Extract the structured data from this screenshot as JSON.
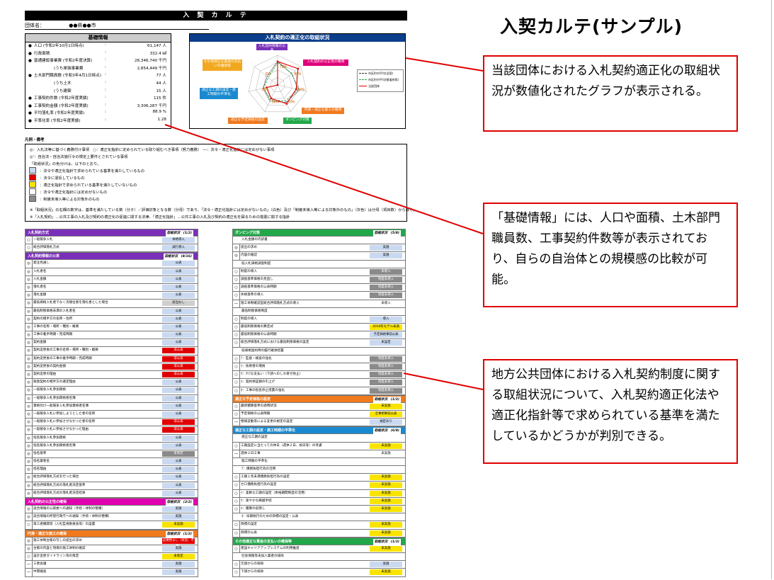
{
  "header": {
    "title": "入 契 カ ル テ",
    "org_label": "団体名：",
    "org_value": "●●県●●市"
  },
  "page_title": "入契カルテ(サンプル)",
  "basic_info": {
    "title": "基礎情報",
    "rows": [
      {
        "label": "人口 (令和2年10月1日時点)",
        "value": "61,147 人",
        "bullet": true
      },
      {
        "label": "行政面積",
        "value": "332.4 ㎢",
        "bullet": true
      },
      {
        "label": "普通建設事業費 (令和2年度決算)",
        "value": "28,346,740 千円",
        "bullet": true
      },
      {
        "label": "(うち単独事業費",
        "value": "2,854,449 千円",
        "bullet": false
      },
      {
        "label": "土木部門職員数 (令和3年4月1日時点)",
        "value": "77 人",
        "bullet": true
      },
      {
        "label": "(うち土木",
        "value": "44 人",
        "bullet": false
      },
      {
        "label": "(うち建築",
        "value": "15 人",
        "bullet": false
      },
      {
        "label": "工事契約件数 (令和2年度実績)",
        "value": "115 件",
        "bullet": true
      },
      {
        "label": "工事契約金額 (令和2年度実績)",
        "value": "3,306,287 千円",
        "bullet": true
      },
      {
        "label": "平均落札率 (令和2年度実績)",
        "value": "88.9 %",
        "bullet": true
      },
      {
        "label": "平準化率 (令和2年度実績)",
        "value": "1.28",
        "bullet": true
      }
    ]
  },
  "chart": {
    "title": "入札契約の適正化の取組状況",
    "categories": [
      {
        "label": "入札契約情報の公表",
        "color": "#7a2fb8"
      },
      {
        "label": "入札契約の公正性の確保",
        "color": "#e0007a"
      },
      {
        "label": "円滑・適正な施工の確保",
        "color": "#f07a1e"
      },
      {
        "label": "ダンピング対策",
        "color": "#22a84a"
      },
      {
        "label": "適正な予定価格の設定",
        "color": "#f07a1e"
      },
      {
        "label": "適正な工期の設定・施工時期の平準化",
        "color": "#1a8ad0"
      },
      {
        "label": "その他適正な賃金の支払いの確保等",
        "color": "#f2a81e"
      }
    ],
    "legend": [
      "市区町村平均(全国)",
      "市区町村平均(都道府県)",
      "当該団体"
    ],
    "percent_labels": [
      "79%",
      "88%",
      "64%",
      "70%",
      "50%",
      "38%",
      "0%"
    ]
  },
  "chart_data": {
    "type": "radar",
    "categories": [
      "入札契約情報の公表",
      "入札契約の公正性の確保",
      "円滑・適正な施工の確保",
      "ダンピング対策",
      "適正な予定価格の設定",
      "適正な工期の設定・施工時期の平準化",
      "その他適正な賃金の支払いの確保等"
    ],
    "series": [
      {
        "name": "市区町村平均(全国)",
        "values": [
          80,
          60,
          75,
          65,
          60,
          50,
          45
        ]
      },
      {
        "name": "市区町村平均(都道府県)",
        "values": [
          75,
          62,
          70,
          60,
          55,
          48,
          40
        ]
      },
      {
        "name": "当該団体",
        "values": [
          79,
          88,
          64,
          70,
          50,
          38,
          0
        ]
      }
    ]
  },
  "legend_box": {
    "heading": "凡例・備考",
    "lines": [
      "◎：入札法等に基づく義務付け事項　○：適正化指針に定められている取り組むべき事項（努力義務）　―：法令・適正化指針には定めがない事項",
      "◎'：自治法・自治法施行令の規定上要件とされている事項",
      "「取組状況」の色分けは、以下のとおり。",
      "：法令や適正化指針で求められている基準を満たしているもの",
      "：法令に違反しているもの",
      "：適正化指針で求められている基準を満たしていないもの",
      "：法令や適正化指針には定めがないもの",
      "：制度未導入等による対象外のもの",
      "※「取組状況」の右欄の数字は、基準を満たしている数（分子）／評価対象となる数（分母）であり、「法令・適正化指針には定めがないもの」（白色）及び「制度未導入等による対象外のもの」（灰色）は分母（項目数）から除く。",
      "※「入札契約」…公共工事の入札及び契約の適正化の促進に関する法律、「適正化指針」…公共工事の入札及び契約の適正化を図るための措置に関する指針"
    ],
    "swatch_colors": [
      "#c9d9f0",
      "#e00000",
      "#f8e400",
      "#ffffff",
      "#8a8a8a"
    ]
  },
  "left_table": [
    {
      "kind": "hdr",
      "label": "入札契約方式",
      "status": "取組状況　(1/2)",
      "color": "#7a2fb8"
    },
    {
      "kind": "row",
      "mark": "○",
      "label": "一般競争入札",
      "value": "本格導入",
      "color": "#c9d9f0"
    },
    {
      "kind": "row",
      "mark": "○",
      "label": "総合評価落札方式",
      "value": "試行導入",
      "color": "#c9d9f0"
    },
    {
      "kind": "hdr",
      "label": "入札契約情報の公表",
      "status": "取組状況　(8/16)",
      "color": "#7a2fb8"
    },
    {
      "kind": "row",
      "mark": "◎",
      "label": "発注見通し",
      "value": "公表",
      "color": "#c9d9f0"
    },
    {
      "kind": "row",
      "mark": "◎",
      "label": "入札者名",
      "value": "公表",
      "color": "#c9d9f0"
    },
    {
      "kind": "row",
      "mark": "◎",
      "label": "入札金額",
      "value": "公表",
      "color": "#c9d9f0"
    },
    {
      "kind": "row",
      "mark": "◎",
      "label": "落札者名",
      "value": "公表",
      "color": "#c9d9f0"
    },
    {
      "kind": "row",
      "mark": "◎",
      "label": "落札金額",
      "value": "公表",
      "color": "#c9d9f0"
    },
    {
      "kind": "row",
      "mark": "◎",
      "label": "最低価格入札者でなく次順位者を落札者とした場合",
      "value": "該当なし",
      "color": "#cfcfcf"
    },
    {
      "kind": "row",
      "mark": "◎",
      "label": "最低制限価格未満の入札者名",
      "value": "公表",
      "color": "#c9d9f0"
    },
    {
      "kind": "row",
      "mark": "◎",
      "label": "契約の相手方の名称・住所",
      "value": "公表",
      "color": "#c9d9f0"
    },
    {
      "kind": "row",
      "mark": "◎",
      "label": "工事の名称・場所・種別・概要",
      "value": "公表",
      "color": "#c9d9f0"
    },
    {
      "kind": "row",
      "mark": "◎",
      "label": "工事の着手時期・完成時期",
      "value": "公表",
      "color": "#c9d9f0"
    },
    {
      "kind": "row",
      "mark": "◎",
      "label": "契約金額",
      "value": "公表",
      "color": "#c9d9f0"
    },
    {
      "kind": "row",
      "mark": "◎",
      "label": "契約変更後の工事の名称・場所・種別・概要",
      "value": "非公表",
      "color": "#e00000"
    },
    {
      "kind": "row",
      "mark": "◎",
      "label": "契約変更後の工事の着手時期・完成時期",
      "value": "非公表",
      "color": "#e00000"
    },
    {
      "kind": "row",
      "mark": "◎",
      "label": "契約変更後の契約金額",
      "value": "非公表",
      "color": "#e00000"
    },
    {
      "kind": "row",
      "mark": "◎",
      "label": "契約変更の理由",
      "value": "非公表",
      "color": "#e00000"
    },
    {
      "kind": "row",
      "mark": "◎",
      "label": "随意契約の相手方の選定理由",
      "value": "公表",
      "color": "#c9d9f0"
    },
    {
      "kind": "row",
      "mark": "◎",
      "label": "一般競争入札参加資格",
      "value": "公表",
      "color": "#c9d9f0"
    },
    {
      "kind": "row",
      "mark": "◎",
      "label": "一般競争入札参加資格者名簿",
      "value": "公表",
      "color": "#c9d9f0"
    },
    {
      "kind": "row",
      "mark": "◎",
      "label": "資格付け一般競争入札参加資格者名簿",
      "value": "公表",
      "color": "#c9d9f0"
    },
    {
      "kind": "row",
      "mark": "◎",
      "label": "一般競争入札に参加しようとした者の名称",
      "value": "公表",
      "color": "#c9d9f0"
    },
    {
      "kind": "row",
      "mark": "◎",
      "label": "一般競争入札に参加させなかった者の名称",
      "value": "非公表",
      "color": "#e00000"
    },
    {
      "kind": "row",
      "mark": "◎",
      "label": "一般競争入札に参加させなかった理由",
      "value": "非公表",
      "color": "#e00000"
    },
    {
      "kind": "row",
      "mark": "◎",
      "label": "指名競争入札参加資格",
      "value": "公表",
      "color": "#c9d9f0"
    },
    {
      "kind": "row",
      "mark": "◎",
      "label": "指名競争入札参加資格者名簿",
      "value": "公表",
      "color": "#c9d9f0"
    },
    {
      "kind": "row",
      "mark": "◎",
      "label": "指名基準",
      "value": "未制定",
      "color": "#8a8a8a"
    },
    {
      "kind": "row",
      "mark": "◎",
      "label": "指名業者名",
      "value": "公表",
      "color": "#c9d9f0"
    },
    {
      "kind": "row",
      "mark": "◎",
      "label": "指名理由",
      "value": "公表",
      "color": "#c9d9f0"
    },
    {
      "kind": "row",
      "mark": "◎",
      "label": "総合評価落札方式を行った場合",
      "value": "公表",
      "color": "#c9d9f0"
    },
    {
      "kind": "row",
      "mark": "◎",
      "label": "総合評価落札方式の落札者決定基準",
      "value": "公表",
      "color": "#c9d9f0"
    },
    {
      "kind": "row",
      "mark": "◎",
      "label": "総合評価落札方式の落札者決定結果",
      "value": "公表",
      "color": "#c9d9f0"
    },
    {
      "kind": "hdr",
      "label": "入札契約の公正性の確保",
      "status": "取組状況　(2/2)",
      "color": "#e000b0"
    },
    {
      "kind": "row",
      "mark": "◎",
      "label": "談合情報の公取委への通知（手続・体制の整備）",
      "value": "実施",
      "color": "#c9d9f0"
    },
    {
      "kind": "row",
      "mark": "◎",
      "label": "談合情報の所管行政庁への通知（手続・体制の整備）",
      "value": "実施",
      "color": "#c9d9f0"
    },
    {
      "kind": "row",
      "mark": "○",
      "label": "第三者機関等（入札監視委員会等）の設置",
      "value": "未実施",
      "color": "#f8e400"
    },
    {
      "kind": "hdr",
      "label": "円滑・適正な施工の確保",
      "status": "取組状況　(1/2)",
      "color": "#f07a1e"
    },
    {
      "kind": "row",
      "mark": "◎",
      "label": "施工体制台帳の写しの提出の求め",
      "value": "必要性なし（状況：不適）",
      "color": "#e00000"
    },
    {
      "kind": "row",
      "mark": "◎",
      "label": "台帳の内容と現場の施工体制の確認",
      "value": "実施",
      "color": "#c9d9f0"
    },
    {
      "kind": "row",
      "mark": "○",
      "label": "設計変更ガイドライン等の策定",
      "value": "未策定",
      "color": "#f8e400"
    },
    {
      "kind": "row",
      "mark": "―",
      "label": "三者会議",
      "value": "実施",
      "color": "#c9d9f0"
    },
    {
      "kind": "row",
      "mark": "―",
      "label": "中間検査",
      "value": "実施",
      "color": "#c9d9f0"
    }
  ],
  "right_table": [
    {
      "kind": "hdr",
      "label": "ダンピング対策",
      "status": "取組状況　(5/8)",
      "color": "#22a84a"
    },
    {
      "kind": "sub",
      "label": "入札金額の内訳書"
    },
    {
      "kind": "row",
      "mark": "◎",
      "label": "提出の求め",
      "value": "実施",
      "color": "#c9d9f0"
    },
    {
      "kind": "row",
      "mark": "◎",
      "label": "内容の確認",
      "value": "実施",
      "color": "#c9d9f0"
    },
    {
      "kind": "sub",
      "label": "低入札価格調査制度"
    },
    {
      "kind": "row",
      "mark": "○",
      "label": "制度の導入",
      "value": "未導入",
      "color": "#8a8a8a"
    },
    {
      "kind": "row",
      "mark": "○",
      "label": "調査基準価格の見直し",
      "value": "制度未導入",
      "color": "#8a8a8a"
    },
    {
      "kind": "row",
      "mark": "○",
      "label": "調査基準価格の公表時期",
      "value": "制度未導入",
      "color": "#8a8a8a"
    },
    {
      "kind": "row",
      "mark": "○",
      "label": "失格基準の導入",
      "value": "制度未導入",
      "color": "#8a8a8a"
    },
    {
      "kind": "row",
      "mark": "―",
      "label": "施工体制確認型総合評価落札方式の導入",
      "value": "未導入",
      "color": "#ffffff"
    },
    {
      "kind": "sub",
      "label": "最低制限価格制度"
    },
    {
      "kind": "row",
      "mark": "○",
      "label": "制度の導入",
      "value": "導入",
      "color": "#c9d9f0"
    },
    {
      "kind": "row",
      "mark": "○",
      "label": "最低制限価格の算定式",
      "value": "2019年モデル未満",
      "color": "#f8e400"
    },
    {
      "kind": "row",
      "mark": "○",
      "label": "最低制限価格の公表時期",
      "value": "予定価格事前公表",
      "color": "#c9d9f0"
    },
    {
      "kind": "row",
      "mark": "○",
      "label": "総合評価落札方式における最低制限価格の設定",
      "value": "未設定",
      "color": "#c9d9f0"
    },
    {
      "kind": "sub",
      "label": "低価格契約時の履行確保措置"
    },
    {
      "kind": "row",
      "mark": "○",
      "label": "ｱ：監督・検査の強化",
      "value": "制度未導入",
      "color": "#8a8a8a"
    },
    {
      "kind": "row",
      "mark": "○",
      "label": "ｲ：技術者の増員",
      "value": "制度未導入",
      "color": "#8a8a8a"
    },
    {
      "kind": "row",
      "mark": "○",
      "label": "ｳ：ｸﾘｱな支払い（下請へのしわ寄せ防止）",
      "value": "制度未導入",
      "color": "#8a8a8a"
    },
    {
      "kind": "row",
      "mark": "○",
      "label": "ｴ：契約保証額の引上げ",
      "value": "制度未導入",
      "color": "#8a8a8a"
    },
    {
      "kind": "row",
      "mark": "○",
      "label": "ｵ：工事の指名停止措置の強化",
      "value": "制度未導入",
      "color": "#8a8a8a"
    },
    {
      "kind": "hdr",
      "label": "適正な予定価格の設定",
      "status": "取組状況　(1/2)",
      "color": "#f07a1e"
    },
    {
      "kind": "row",
      "mark": "○",
      "label": "最新積算基準の適用状況",
      "value": "未実施",
      "color": "#f8e400"
    },
    {
      "kind": "row",
      "mark": "○",
      "label": "予定価格の公表時期",
      "value": "全事例事前公表",
      "color": "#f8e400"
    },
    {
      "kind": "row",
      "mark": "―",
      "label": "物価変動等による変更の規定の設定",
      "value": "規定あり",
      "color": "#c9d9f0"
    },
    {
      "kind": "hdr",
      "label": "適正な工期の設定・施工時期の平準化",
      "status": "取組状況　(6/8)",
      "color": "#1a8ad0"
    },
    {
      "kind": "sub",
      "label": "適正な工期の設定"
    },
    {
      "kind": "row",
      "mark": "○",
      "label": "工期設定に当たっての休日（週休２日、祝日等）の考慮",
      "value": "未実施",
      "color": "#f8e400"
    },
    {
      "kind": "row",
      "mark": "―",
      "label": "週休２日工事",
      "value": "未実施",
      "color": "#ffffff"
    },
    {
      "kind": "sub",
      "label": "施工時期の平準化"
    },
    {
      "kind": "sub",
      "label": "ｱ：債務負担行為の活用"
    },
    {
      "kind": "row",
      "mark": "○",
      "label": "工期１年未満債務負担行為の設定",
      "value": "未実施",
      "color": "#f8e400"
    },
    {
      "kind": "row",
      "mark": "○",
      "label": "ゼロ債務負担行為の設定",
      "value": "未実施",
      "color": "#f8e400"
    },
    {
      "kind": "row",
      "mark": "○",
      "label": "ｲ：柔軟な工期の設定（余裕期間制度の活用）",
      "value": "未実施",
      "color": "#f8e400"
    },
    {
      "kind": "row",
      "mark": "○",
      "label": "ｳ：速やかな繰越手続",
      "value": "未実施",
      "color": "#f8e400"
    },
    {
      "kind": "row",
      "mark": "○",
      "label": "ｴ：積算の前倒し",
      "value": "未実施",
      "color": "#f8e400"
    },
    {
      "kind": "sub",
      "label": "ｵ：早期執行のための目標の設定・公表"
    },
    {
      "kind": "row",
      "mark": "○",
      "label": "目標の設定",
      "value": "未実施",
      "color": "#f8e400"
    },
    {
      "kind": "row",
      "mark": "○",
      "label": "目標の公表",
      "value": "未実施",
      "color": "#f8e400"
    },
    {
      "kind": "hdr",
      "label": "その他適正な賃金の支払いの確保等",
      "status": "取組状況　(1/3)",
      "color": "#22a84a"
    },
    {
      "kind": "row",
      "mark": "○",
      "label": "建設キャリアアップシステムの利用推進",
      "value": "未実施",
      "color": "#f8e400"
    },
    {
      "kind": "sub",
      "label": "社会保険等未加入業者の排除"
    },
    {
      "kind": "row",
      "mark": "○",
      "label": "元請からの排除",
      "value": "実施",
      "color": "#c9d9f0"
    },
    {
      "kind": "row",
      "mark": "○",
      "label": "下請からの排除",
      "value": "未実施",
      "color": "#f8e400"
    }
  ],
  "callouts": [
    {
      "text": "当該団体における入札契約適正化の取組状況が数値化されたグラフが表示される。"
    },
    {
      "text": "「基礎情報」には、人口や面積、土木部門職員数、工事契約件数等が表示されており、自らの自治体との規模感の比較が可能。"
    },
    {
      "text": "地方公共団体における入札契約制度に関する取組状況について、入札契約適正化法や適正化指針等で求められている基準を満たしているかどうかが判別できる。"
    }
  ]
}
